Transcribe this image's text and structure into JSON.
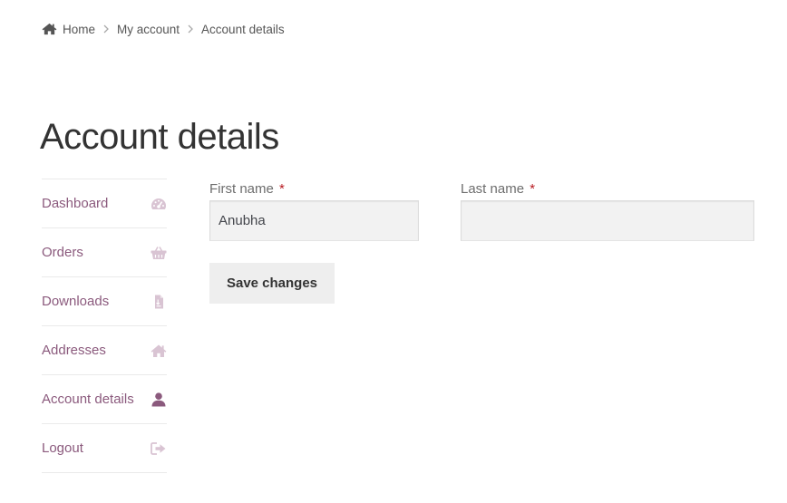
{
  "breadcrumb": {
    "home_icon": "home-icon",
    "items": [
      "Home",
      "My account",
      "Account details"
    ]
  },
  "page": {
    "title": "Account details"
  },
  "nav": {
    "items": [
      {
        "label": "Dashboard",
        "icon": "dashboard-gauge-icon"
      },
      {
        "label": "Orders",
        "icon": "basket-icon"
      },
      {
        "label": "Downloads",
        "icon": "file-download-icon"
      },
      {
        "label": "Addresses",
        "icon": "home-icon"
      },
      {
        "label": "Account details",
        "icon": "user-icon",
        "active": true
      },
      {
        "label": "Logout",
        "icon": "sign-out-icon"
      }
    ],
    "icon_color": "#d9c4d3",
    "active_icon_color": "#8b5a7d",
    "link_color": "#8b5a7d"
  },
  "form": {
    "first_name": {
      "label": "First name",
      "required_mark": "*",
      "value": "Anubha"
    },
    "last_name": {
      "label": "Last name",
      "required_mark": "*",
      "value": ""
    },
    "save_label": "Save changes"
  }
}
